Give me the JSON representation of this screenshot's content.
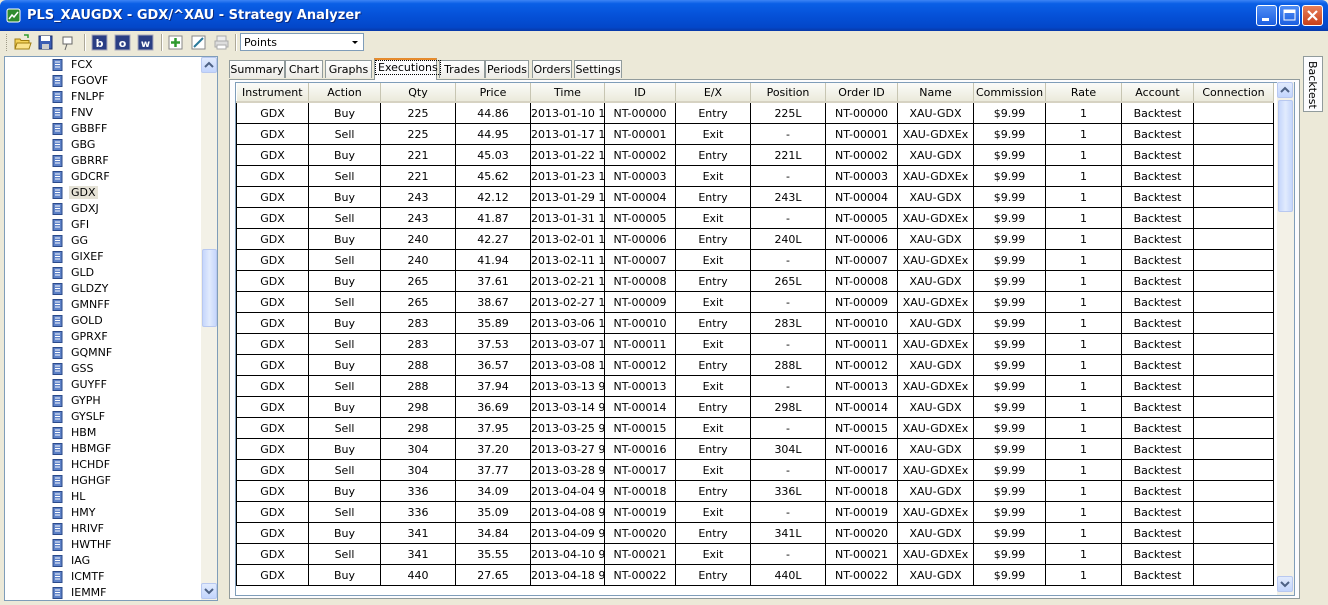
{
  "window": {
    "title": "PLS_XAUGDX - GDX/^XAU - Strategy Analyzer"
  },
  "toolbar": {
    "buttons": [
      "open-folder-icon",
      "save-icon",
      "pin-icon",
      "b-button",
      "o-button",
      "w-button",
      "add-icon",
      "edit-icon",
      "print-icon"
    ],
    "display_unit": "Points"
  },
  "instrument_list": {
    "selected": "GDX",
    "items": [
      "FCX",
      "FGOVF",
      "FNLPF",
      "FNV",
      "GBBFF",
      "GBG",
      "GBRRF",
      "GDCRF",
      "GDX",
      "GDXJ",
      "GFI",
      "GG",
      "GIXEF",
      "GLD",
      "GLDZY",
      "GMNFF",
      "GOLD",
      "GPRXF",
      "GQMNF",
      "GSS",
      "GUYFF",
      "GYPH",
      "GYSLF",
      "HBM",
      "HBMGF",
      "HCHDF",
      "HGHGF",
      "HL",
      "HMY",
      "HRIVF",
      "HWTHF",
      "IAG",
      "ICMTF",
      "IEMMF"
    ]
  },
  "tabs": [
    {
      "label": "Summary"
    },
    {
      "label": "Chart"
    },
    {
      "label": "Graphs"
    },
    {
      "label": "Executions",
      "active": true
    },
    {
      "label": "Trades"
    },
    {
      "label": "Periods"
    },
    {
      "label": "Orders"
    },
    {
      "label": "Settings"
    }
  ],
  "side_tab": {
    "label": "Backtest"
  },
  "executions": {
    "columns": [
      "Instrument",
      "Action",
      "Qty",
      "Price",
      "Time",
      "ID",
      "E/X",
      "Position",
      "Order ID",
      "Name",
      "Commission",
      "Rate",
      "Account",
      "Connection"
    ],
    "rows": [
      [
        "GDX",
        "Buy",
        "225",
        "44.86",
        "2013-01-10 1",
        "NT-00000",
        "Entry",
        "225L",
        "NT-00000",
        "XAU-GDX",
        "$9.99",
        "1",
        "Backtest",
        ""
      ],
      [
        "GDX",
        "Sell",
        "225",
        "44.95",
        "2013-01-17 1",
        "NT-00001",
        "Exit",
        "-",
        "NT-00001",
        "XAU-GDXEx",
        "$9.99",
        "1",
        "Backtest",
        ""
      ],
      [
        "GDX",
        "Buy",
        "221",
        "45.03",
        "2013-01-22 1",
        "NT-00002",
        "Entry",
        "221L",
        "NT-00002",
        "XAU-GDX",
        "$9.99",
        "1",
        "Backtest",
        ""
      ],
      [
        "GDX",
        "Sell",
        "221",
        "45.62",
        "2013-01-23 1",
        "NT-00003",
        "Exit",
        "-",
        "NT-00003",
        "XAU-GDXEx",
        "$9.99",
        "1",
        "Backtest",
        ""
      ],
      [
        "GDX",
        "Buy",
        "243",
        "42.12",
        "2013-01-29 1",
        "NT-00004",
        "Entry",
        "243L",
        "NT-00004",
        "XAU-GDX",
        "$9.99",
        "1",
        "Backtest",
        ""
      ],
      [
        "GDX",
        "Sell",
        "243",
        "41.87",
        "2013-01-31 1",
        "NT-00005",
        "Exit",
        "-",
        "NT-00005",
        "XAU-GDXEx",
        "$9.99",
        "1",
        "Backtest",
        ""
      ],
      [
        "GDX",
        "Buy",
        "240",
        "42.27",
        "2013-02-01 1",
        "NT-00006",
        "Entry",
        "240L",
        "NT-00006",
        "XAU-GDX",
        "$9.99",
        "1",
        "Backtest",
        ""
      ],
      [
        "GDX",
        "Sell",
        "240",
        "41.94",
        "2013-02-11 1",
        "NT-00007",
        "Exit",
        "-",
        "NT-00007",
        "XAU-GDXEx",
        "$9.99",
        "1",
        "Backtest",
        ""
      ],
      [
        "GDX",
        "Buy",
        "265",
        "37.61",
        "2013-02-21 1",
        "NT-00008",
        "Entry",
        "265L",
        "NT-00008",
        "XAU-GDX",
        "$9.99",
        "1",
        "Backtest",
        ""
      ],
      [
        "GDX",
        "Sell",
        "265",
        "38.67",
        "2013-02-27 1",
        "NT-00009",
        "Exit",
        "-",
        "NT-00009",
        "XAU-GDXEx",
        "$9.99",
        "1",
        "Backtest",
        ""
      ],
      [
        "GDX",
        "Buy",
        "283",
        "35.89",
        "2013-03-06 1",
        "NT-00010",
        "Entry",
        "283L",
        "NT-00010",
        "XAU-GDX",
        "$9.99",
        "1",
        "Backtest",
        ""
      ],
      [
        "GDX",
        "Sell",
        "283",
        "37.53",
        "2013-03-07 1",
        "NT-00011",
        "Exit",
        "-",
        "NT-00011",
        "XAU-GDXEx",
        "$9.99",
        "1",
        "Backtest",
        ""
      ],
      [
        "GDX",
        "Buy",
        "288",
        "36.57",
        "2013-03-08 1",
        "NT-00012",
        "Entry",
        "288L",
        "NT-00012",
        "XAU-GDX",
        "$9.99",
        "1",
        "Backtest",
        ""
      ],
      [
        "GDX",
        "Sell",
        "288",
        "37.94",
        "2013-03-13 9",
        "NT-00013",
        "Exit",
        "-",
        "NT-00013",
        "XAU-GDXEx",
        "$9.99",
        "1",
        "Backtest",
        ""
      ],
      [
        "GDX",
        "Buy",
        "298",
        "36.69",
        "2013-03-14 9",
        "NT-00014",
        "Entry",
        "298L",
        "NT-00014",
        "XAU-GDX",
        "$9.99",
        "1",
        "Backtest",
        ""
      ],
      [
        "GDX",
        "Sell",
        "298",
        "37.95",
        "2013-03-25 9",
        "NT-00015",
        "Exit",
        "-",
        "NT-00015",
        "XAU-GDXEx",
        "$9.99",
        "1",
        "Backtest",
        ""
      ],
      [
        "GDX",
        "Buy",
        "304",
        "37.20",
        "2013-03-27 9",
        "NT-00016",
        "Entry",
        "304L",
        "NT-00016",
        "XAU-GDX",
        "$9.99",
        "1",
        "Backtest",
        ""
      ],
      [
        "GDX",
        "Sell",
        "304",
        "37.77",
        "2013-03-28 9",
        "NT-00017",
        "Exit",
        "-",
        "NT-00017",
        "XAU-GDXEx",
        "$9.99",
        "1",
        "Backtest",
        ""
      ],
      [
        "GDX",
        "Buy",
        "336",
        "34.09",
        "2013-04-04 9",
        "NT-00018",
        "Entry",
        "336L",
        "NT-00018",
        "XAU-GDX",
        "$9.99",
        "1",
        "Backtest",
        ""
      ],
      [
        "GDX",
        "Sell",
        "336",
        "35.09",
        "2013-04-08 9",
        "NT-00019",
        "Exit",
        "-",
        "NT-00019",
        "XAU-GDXEx",
        "$9.99",
        "1",
        "Backtest",
        ""
      ],
      [
        "GDX",
        "Buy",
        "341",
        "34.84",
        "2013-04-09 9",
        "NT-00020",
        "Entry",
        "341L",
        "NT-00020",
        "XAU-GDX",
        "$9.99",
        "1",
        "Backtest",
        ""
      ],
      [
        "GDX",
        "Sell",
        "341",
        "35.55",
        "2013-04-10 9",
        "NT-00021",
        "Exit",
        "-",
        "NT-00021",
        "XAU-GDXEx",
        "$9.99",
        "1",
        "Backtest",
        ""
      ],
      [
        "GDX",
        "Buy",
        "440",
        "27.65",
        "2013-04-18 9",
        "NT-00022",
        "Entry",
        "440L",
        "NT-00022",
        "XAU-GDX",
        "$9.99",
        "1",
        "Backtest",
        ""
      ]
    ]
  },
  "colors": {
    "titlebar": "#0551d8",
    "active_tab_accent": "#e68b2c",
    "grid_border": "#000000"
  }
}
